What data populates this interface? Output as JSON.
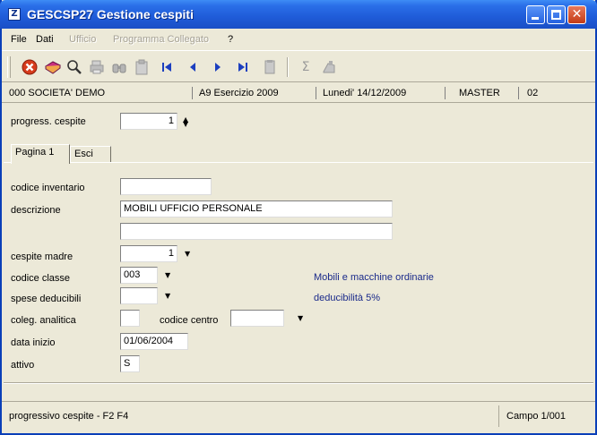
{
  "window": {
    "title": "GESCSP27  Gestione cespiti",
    "app_icon": "Z"
  },
  "menu": [
    {
      "label": "File",
      "enabled": true
    },
    {
      "label": "Dati",
      "enabled": true
    },
    {
      "label": "Ufficio",
      "enabled": false
    },
    {
      "label": "Programma Collegato",
      "enabled": false
    },
    {
      "label": "?",
      "enabled": true
    }
  ],
  "toolbar": {
    "icons": [
      "close-icon",
      "book-icon",
      "search-icon",
      "print-icon",
      "binoculars-icon",
      "clipboard-icon",
      "first-record-icon",
      "previous-record-icon",
      "next-record-icon",
      "last-record-icon",
      "document-icon",
      "sum-icon",
      "calculator-icon"
    ]
  },
  "info": {
    "company": "000 SOCIETA' DEMO",
    "year": "A9 Esercizio 2009",
    "date": "Lunedi'  14/12/2009",
    "user": "MASTER",
    "code": "02"
  },
  "header_field": {
    "label": "progress. cespite",
    "value": "1"
  },
  "tabs": [
    {
      "label": "Pagina 1",
      "active": true
    },
    {
      "label": "Esci",
      "active": false
    }
  ],
  "form": {
    "codice_inventario": {
      "label": "codice inventario",
      "value": ""
    },
    "descrizione": {
      "label": "descrizione",
      "value": "MOBILI UFFICIO PERSONALE",
      "value2": ""
    },
    "cespite_madre": {
      "label": "cespite madre",
      "value": "1"
    },
    "codice_classe": {
      "label": "codice classe",
      "value": "003",
      "note": "Mobili e macchine ordinarie"
    },
    "spese_deducibili": {
      "label": "spese deducibili",
      "value": "",
      "note": "deducibilità 5%"
    },
    "coleg_analitica": {
      "label": "coleg. analitica",
      "value": ""
    },
    "codice_centro": {
      "label": "codice centro",
      "value": ""
    },
    "data_inizio": {
      "label": "data inizio",
      "value": "01/06/2004"
    },
    "attivo": {
      "label": "attivo",
      "value": "S"
    }
  },
  "status": {
    "left": "progressivo cespite    - F2  F4",
    "right": "Campo  1/001"
  },
  "colors": {
    "titlebar": "#1f5bd8",
    "window_bg": "#ece9d8",
    "note_text": "#1a2a8a"
  }
}
